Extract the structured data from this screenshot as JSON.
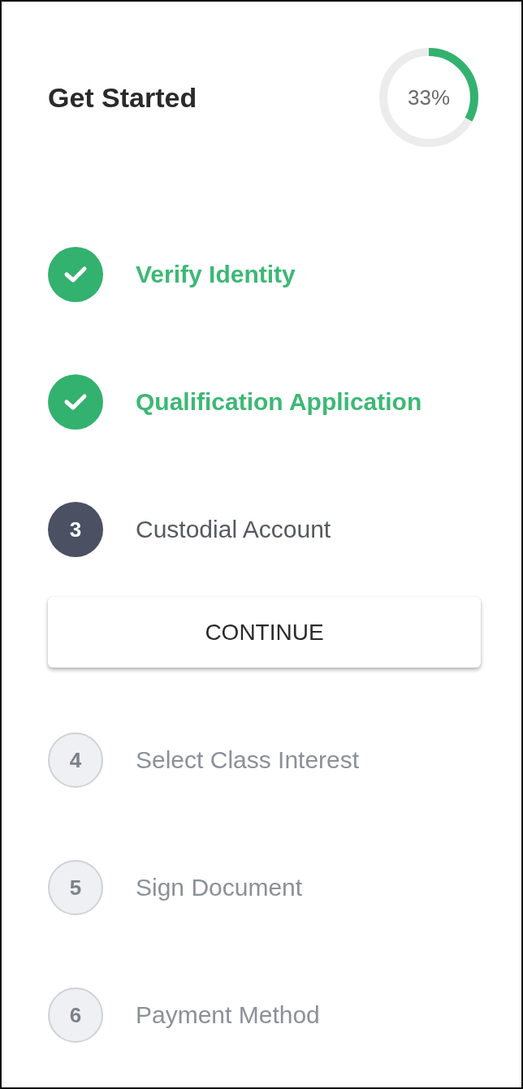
{
  "title": "Get Started",
  "progress": {
    "level": 0.33,
    "label": "33%"
  },
  "steps": [
    {
      "label": "Verify Identity",
      "kind": "done"
    },
    {
      "label": "Qualification Application",
      "kind": "done"
    },
    {
      "number": "3",
      "label": "Custodial Account",
      "kind": "current",
      "button": "CONTINUE"
    },
    {
      "number": "4",
      "label": "Select Class Interest",
      "kind": "pending"
    },
    {
      "number": "5",
      "label": "Sign Document",
      "kind": "pending"
    },
    {
      "number": "6",
      "label": "Payment Method",
      "kind": "pending"
    }
  ]
}
